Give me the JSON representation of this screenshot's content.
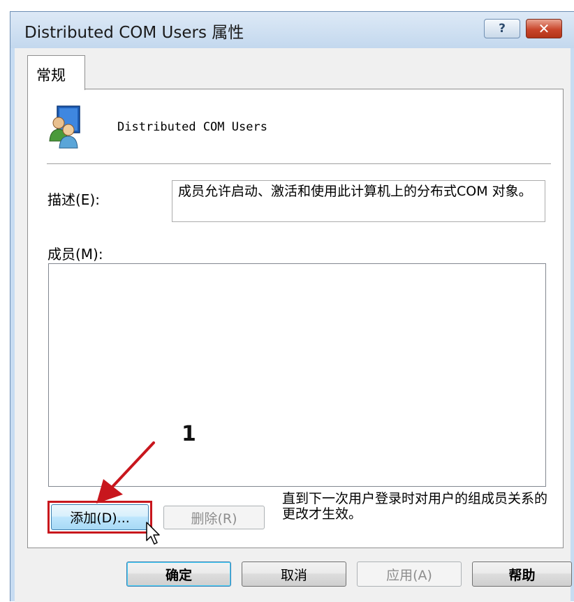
{
  "window": {
    "title": "Distributed COM Users 属性",
    "help_button": "?",
    "close_button": "✕"
  },
  "tabs": [
    {
      "label": "常规"
    }
  ],
  "group": {
    "name": "Distributed COM Users",
    "icon": "user-group-icon"
  },
  "description": {
    "label": "描述(E):",
    "value": "成员允许启动、激活和使用此计算机上的分布式COM 对象。"
  },
  "members": {
    "label": "成员(M):",
    "items": []
  },
  "buttons": {
    "add": "添加(D)...",
    "remove": "删除(R)"
  },
  "note": "直到下一次用户登录时对用户的组成员关系的更改才生效。",
  "annotation": {
    "number": "1",
    "color": "#c8161d"
  },
  "footer": {
    "ok": "确定",
    "cancel": "取消",
    "apply": "应用(A)",
    "help": "帮助"
  }
}
